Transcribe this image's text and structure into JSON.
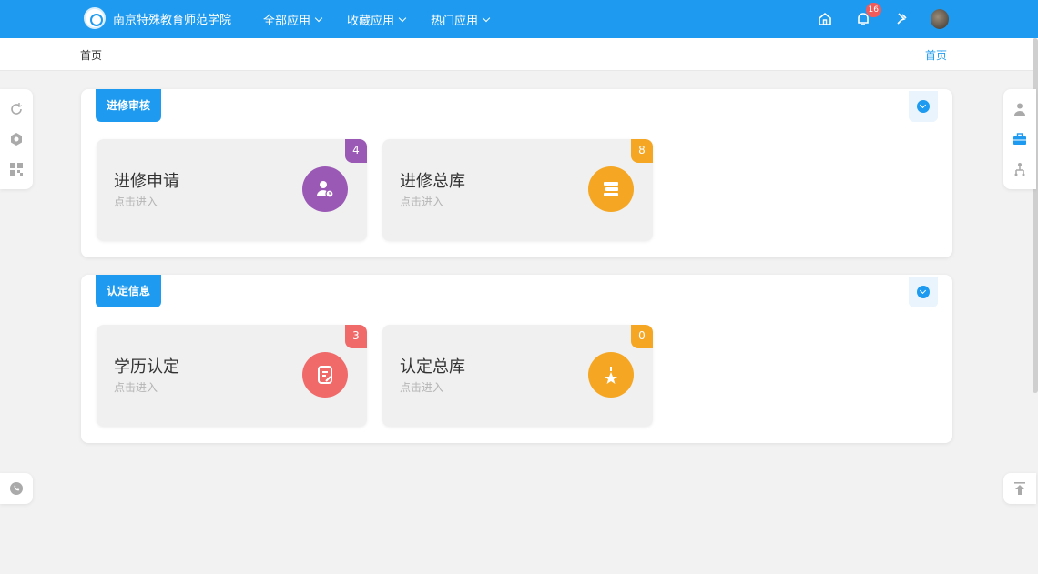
{
  "header": {
    "logo_text": "南京特殊教育师范学院",
    "nav": [
      {
        "label": "全部应用"
      },
      {
        "label": "收藏应用"
      },
      {
        "label": "热门应用"
      }
    ],
    "notification_count": "16",
    "icons": [
      "home-icon",
      "bell-icon",
      "pin-icon",
      "avatar"
    ]
  },
  "breadcrumb": {
    "current": "首页",
    "right_link": "首页"
  },
  "sections": [
    {
      "title": "进修审核",
      "cards": [
        {
          "title": "进修申请",
          "subtitle": "点击进入",
          "count": "4",
          "color": "#9b59b6",
          "icon": "user-clock-icon"
        },
        {
          "title": "进修总库",
          "subtitle": "点击进入",
          "count": "8",
          "color": "#f5a623",
          "icon": "books-icon"
        }
      ]
    },
    {
      "title": "认定信息",
      "cards": [
        {
          "title": "学历认定",
          "subtitle": "点击进入",
          "count": "3",
          "color": "#f06a6a",
          "icon": "document-edit-icon"
        },
        {
          "title": "认定总库",
          "subtitle": "点击进入",
          "count": "0",
          "color": "#f5a623",
          "icon": "medal-icon"
        }
      ]
    }
  ],
  "colors": {
    "primary": "#1e9bf0",
    "background": "#f2f2f2"
  }
}
